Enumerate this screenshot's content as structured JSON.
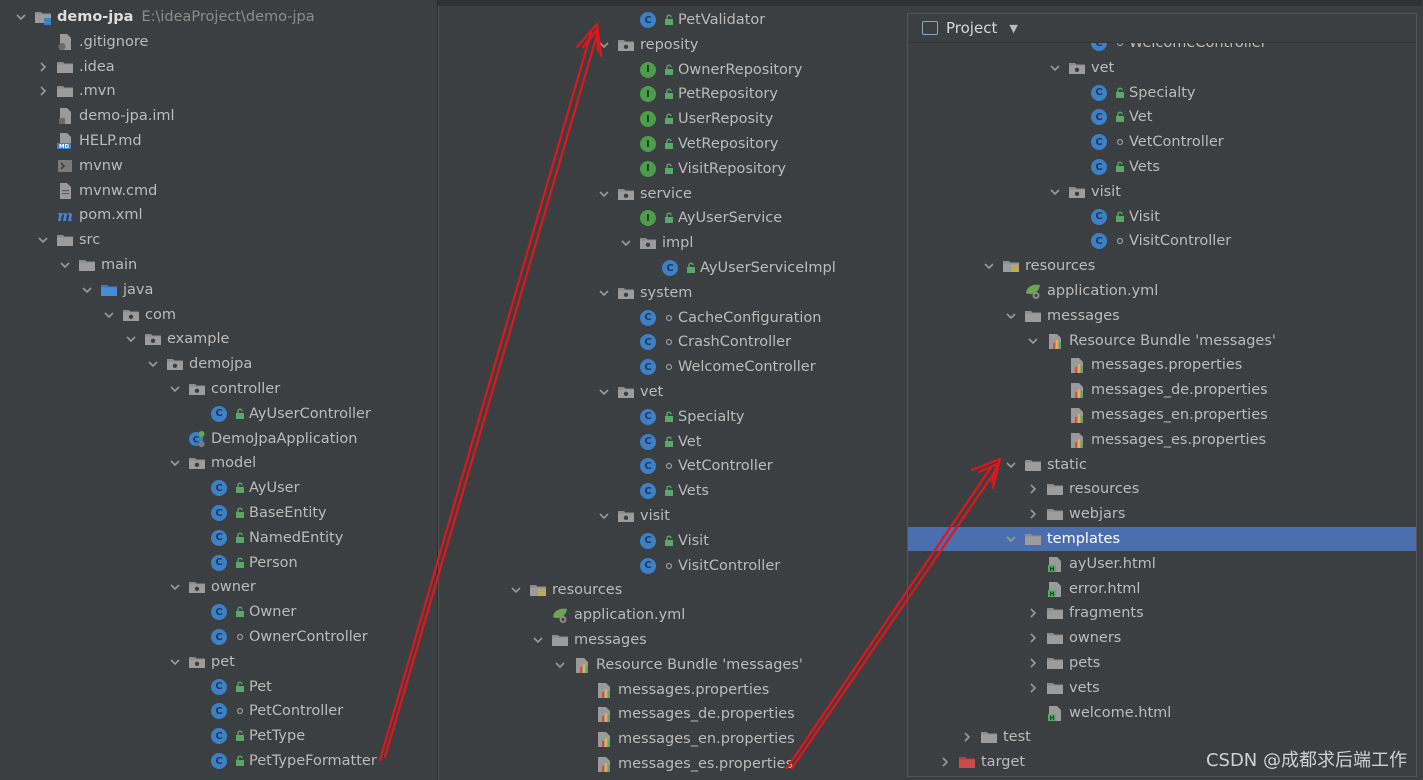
{
  "left_tree": [
    {
      "d": 0,
      "arrow": "down",
      "icon": "project-module-icon",
      "label": "demo-jpa",
      "bold": true,
      "path": "E:\\ideaProject\\demo-jpa"
    },
    {
      "d": 1,
      "arrow": "none",
      "icon": "git-ignore-file-icon",
      "label": ".gitignore"
    },
    {
      "d": 1,
      "arrow": "right",
      "icon": "folder-icon",
      "label": ".idea"
    },
    {
      "d": 1,
      "arrow": "right",
      "icon": "folder-icon",
      "label": ".mvn"
    },
    {
      "d": 1,
      "arrow": "none",
      "icon": "iml-file-icon",
      "label": "demo-jpa.iml"
    },
    {
      "d": 1,
      "arrow": "none",
      "icon": "markdown-file-icon",
      "label": "HELP.md"
    },
    {
      "d": 1,
      "arrow": "none",
      "icon": "shell-script-icon",
      "label": "mvnw"
    },
    {
      "d": 1,
      "arrow": "none",
      "icon": "text-file-icon",
      "label": "mvnw.cmd"
    },
    {
      "d": 1,
      "arrow": "none",
      "icon": "maven-pom-icon",
      "label": "pom.xml"
    },
    {
      "d": 1,
      "arrow": "down",
      "icon": "folder-icon",
      "label": "src"
    },
    {
      "d": 2,
      "arrow": "down",
      "icon": "folder-icon",
      "label": "main"
    },
    {
      "d": 3,
      "arrow": "down",
      "icon": "source-folder-icon",
      "label": "java"
    },
    {
      "d": 4,
      "arrow": "down",
      "icon": "package-icon",
      "label": "com"
    },
    {
      "d": 5,
      "arrow": "down",
      "icon": "package-icon",
      "label": "example"
    },
    {
      "d": 6,
      "arrow": "down",
      "icon": "package-icon",
      "label": "demojpa"
    },
    {
      "d": 7,
      "arrow": "down",
      "icon": "package-icon",
      "label": "controller"
    },
    {
      "d": 8,
      "arrow": "none",
      "icon": "java-class-icon",
      "label": "AyUserController",
      "access": "public"
    },
    {
      "d": 7,
      "arrow": "none",
      "icon": "spring-boot-app-icon",
      "label": "DemoJpaApplication",
      "nogap": true
    },
    {
      "d": 7,
      "arrow": "down",
      "icon": "package-icon",
      "label": "model"
    },
    {
      "d": 8,
      "arrow": "none",
      "icon": "java-class-icon",
      "label": "AyUser",
      "access": "public"
    },
    {
      "d": 8,
      "arrow": "none",
      "icon": "java-class-icon",
      "label": "BaseEntity",
      "access": "public"
    },
    {
      "d": 8,
      "arrow": "none",
      "icon": "java-class-icon",
      "label": "NamedEntity",
      "access": "public"
    },
    {
      "d": 8,
      "arrow": "none",
      "icon": "java-class-icon",
      "label": "Person",
      "access": "public"
    },
    {
      "d": 7,
      "arrow": "down",
      "icon": "package-icon",
      "label": "owner"
    },
    {
      "d": 8,
      "arrow": "none",
      "icon": "java-class-icon",
      "label": "Owner",
      "access": "public"
    },
    {
      "d": 8,
      "arrow": "none",
      "icon": "java-class-icon",
      "label": "OwnerController",
      "access": "package"
    },
    {
      "d": 7,
      "arrow": "down",
      "icon": "package-icon",
      "label": "pet"
    },
    {
      "d": 8,
      "arrow": "none",
      "icon": "java-class-icon",
      "label": "Pet",
      "access": "public"
    },
    {
      "d": 8,
      "arrow": "none",
      "icon": "java-class-icon",
      "label": "PetController",
      "access": "package"
    },
    {
      "d": 8,
      "arrow": "none",
      "icon": "java-class-icon",
      "label": "PetType",
      "access": "public"
    },
    {
      "d": 8,
      "arrow": "none",
      "icon": "java-class-icon",
      "label": "PetTypeFormatter",
      "access": "public"
    }
  ],
  "middle_tree": [
    {
      "d": 5,
      "arrow": "none",
      "icon": "java-class-icon",
      "label": "PetValidator",
      "access": "public"
    },
    {
      "d": 4,
      "arrow": "down",
      "icon": "package-icon",
      "label": "reposity"
    },
    {
      "d": 5,
      "arrow": "none",
      "icon": "java-interface-icon",
      "label": "OwnerRepository",
      "access": "public"
    },
    {
      "d": 5,
      "arrow": "none",
      "icon": "java-interface-icon",
      "label": "PetRepository",
      "access": "public"
    },
    {
      "d": 5,
      "arrow": "none",
      "icon": "java-interface-icon",
      "label": "UserReposity",
      "access": "public"
    },
    {
      "d": 5,
      "arrow": "none",
      "icon": "java-interface-icon",
      "label": "VetRepository",
      "access": "public"
    },
    {
      "d": 5,
      "arrow": "none",
      "icon": "java-interface-icon",
      "label": "VisitRepository",
      "access": "public"
    },
    {
      "d": 4,
      "arrow": "down",
      "icon": "package-icon",
      "label": "service"
    },
    {
      "d": 5,
      "arrow": "none",
      "icon": "java-interface-icon",
      "label": "AyUserService",
      "access": "public"
    },
    {
      "d": 5,
      "arrow": "down",
      "icon": "package-icon",
      "label": "impl"
    },
    {
      "d": 6,
      "arrow": "none",
      "icon": "java-class-icon",
      "label": "AyUserServiceImpl",
      "access": "public"
    },
    {
      "d": 4,
      "arrow": "down",
      "icon": "package-icon",
      "label": "system"
    },
    {
      "d": 5,
      "arrow": "none",
      "icon": "java-class-icon",
      "label": "CacheConfiguration",
      "access": "package"
    },
    {
      "d": 5,
      "arrow": "none",
      "icon": "java-class-icon",
      "label": "CrashController",
      "access": "package"
    },
    {
      "d": 5,
      "arrow": "none",
      "icon": "java-class-icon",
      "label": "WelcomeController",
      "access": "package"
    },
    {
      "d": 4,
      "arrow": "down",
      "icon": "package-icon",
      "label": "vet"
    },
    {
      "d": 5,
      "arrow": "none",
      "icon": "java-class-icon",
      "label": "Specialty",
      "access": "public"
    },
    {
      "d": 5,
      "arrow": "none",
      "icon": "java-class-icon",
      "label": "Vet",
      "access": "public"
    },
    {
      "d": 5,
      "arrow": "none",
      "icon": "java-class-icon",
      "label": "VetController",
      "access": "package"
    },
    {
      "d": 5,
      "arrow": "none",
      "icon": "java-class-icon",
      "label": "Vets",
      "access": "public"
    },
    {
      "d": 4,
      "arrow": "down",
      "icon": "package-icon",
      "label": "visit"
    },
    {
      "d": 5,
      "arrow": "none",
      "icon": "java-class-icon",
      "label": "Visit",
      "access": "public"
    },
    {
      "d": 5,
      "arrow": "none",
      "icon": "java-class-icon",
      "label": "VisitController",
      "access": "package"
    },
    {
      "d": 0,
      "arrow": "down",
      "icon": "resources-folder-icon",
      "label": "resources"
    },
    {
      "d": 1,
      "arrow": "none",
      "icon": "spring-yaml-icon",
      "label": "application.yml",
      "nogap": true
    },
    {
      "d": 1,
      "arrow": "down",
      "icon": "folder-icon",
      "label": "messages"
    },
    {
      "d": 2,
      "arrow": "down",
      "icon": "resource-bundle-icon",
      "label": "Resource Bundle 'messages'"
    },
    {
      "d": 3,
      "arrow": "none",
      "icon": "properties-file-icon",
      "label": "messages.properties",
      "nogap": true
    },
    {
      "d": 3,
      "arrow": "none",
      "icon": "properties-file-icon",
      "label": "messages_de.properties",
      "nogap": true
    },
    {
      "d": 3,
      "arrow": "none",
      "icon": "properties-file-icon",
      "label": "messages_en.properties",
      "nogap": true
    },
    {
      "d": 3,
      "arrow": "none",
      "icon": "properties-file-icon",
      "label": "messages_es.properties",
      "nogap": true
    }
  ],
  "right_panel": {
    "header": {
      "label": "Project",
      "caret": "▼"
    },
    "rows": [
      {
        "d": 5,
        "arrow": "none",
        "icon": "java-class-icon",
        "label": "WelcomeController",
        "access": "package"
      },
      {
        "d": 4,
        "arrow": "down",
        "icon": "package-icon",
        "label": "vet"
      },
      {
        "d": 5,
        "arrow": "none",
        "icon": "java-class-icon",
        "label": "Specialty",
        "access": "public"
      },
      {
        "d": 5,
        "arrow": "none",
        "icon": "java-class-icon",
        "label": "Vet",
        "access": "public"
      },
      {
        "d": 5,
        "arrow": "none",
        "icon": "java-class-icon",
        "label": "VetController",
        "access": "package"
      },
      {
        "d": 5,
        "arrow": "none",
        "icon": "java-class-icon",
        "label": "Vets",
        "access": "public"
      },
      {
        "d": 4,
        "arrow": "down",
        "icon": "package-icon",
        "label": "visit"
      },
      {
        "d": 5,
        "arrow": "none",
        "icon": "java-class-icon",
        "label": "Visit",
        "access": "public"
      },
      {
        "d": 5,
        "arrow": "none",
        "icon": "java-class-icon",
        "label": "VisitController",
        "access": "package"
      },
      {
        "d": 1,
        "arrow": "down",
        "icon": "resources-folder-icon",
        "label": "resources"
      },
      {
        "d": 2,
        "arrow": "none",
        "icon": "spring-yaml-icon",
        "label": "application.yml",
        "nogap": true
      },
      {
        "d": 2,
        "arrow": "down",
        "icon": "folder-icon",
        "label": "messages"
      },
      {
        "d": 3,
        "arrow": "down",
        "icon": "resource-bundle-icon",
        "label": "Resource Bundle 'messages'"
      },
      {
        "d": 4,
        "arrow": "none",
        "icon": "properties-file-icon",
        "label": "messages.properties",
        "nogap": true
      },
      {
        "d": 4,
        "arrow": "none",
        "icon": "properties-file-icon",
        "label": "messages_de.properties",
        "nogap": true
      },
      {
        "d": 4,
        "arrow": "none",
        "icon": "properties-file-icon",
        "label": "messages_en.properties",
        "nogap": true
      },
      {
        "d": 4,
        "arrow": "none",
        "icon": "properties-file-icon",
        "label": "messages_es.properties",
        "nogap": true
      },
      {
        "d": 2,
        "arrow": "down",
        "icon": "folder-icon",
        "label": "static"
      },
      {
        "d": 3,
        "arrow": "right",
        "icon": "folder-icon",
        "label": "resources"
      },
      {
        "d": 3,
        "arrow": "right",
        "icon": "folder-icon",
        "label": "webjars"
      },
      {
        "d": 2,
        "arrow": "down",
        "icon": "folder-icon",
        "label": "templates",
        "selected": true
      },
      {
        "d": 3,
        "arrow": "none",
        "icon": "html-file-icon",
        "label": "ayUser.html",
        "nogap": true
      },
      {
        "d": 3,
        "arrow": "none",
        "icon": "html-file-icon",
        "label": "error.html",
        "nogap": true
      },
      {
        "d": 3,
        "arrow": "right",
        "icon": "folder-icon",
        "label": "fragments"
      },
      {
        "d": 3,
        "arrow": "right",
        "icon": "folder-icon",
        "label": "owners"
      },
      {
        "d": 3,
        "arrow": "right",
        "icon": "folder-icon",
        "label": "pets"
      },
      {
        "d": 3,
        "arrow": "right",
        "icon": "folder-icon",
        "label": "vets"
      },
      {
        "d": 3,
        "arrow": "none",
        "icon": "html-file-icon",
        "label": "welcome.html",
        "nogap": true
      },
      {
        "d": 0,
        "arrow": "right",
        "icon": "folder-icon",
        "label": "test"
      },
      {
        "d": -1,
        "arrow": "right",
        "icon": "excluded-folder-icon",
        "label": "target"
      }
    ]
  },
  "watermark": "CSDN @成都求后端工作",
  "colors": {
    "background": "#3c3f41",
    "selection": "#4b6eaf",
    "annotation_arrow": "#e0161b",
    "class_icon": "#3d80c6",
    "interface_icon": "#4c9e4c"
  }
}
